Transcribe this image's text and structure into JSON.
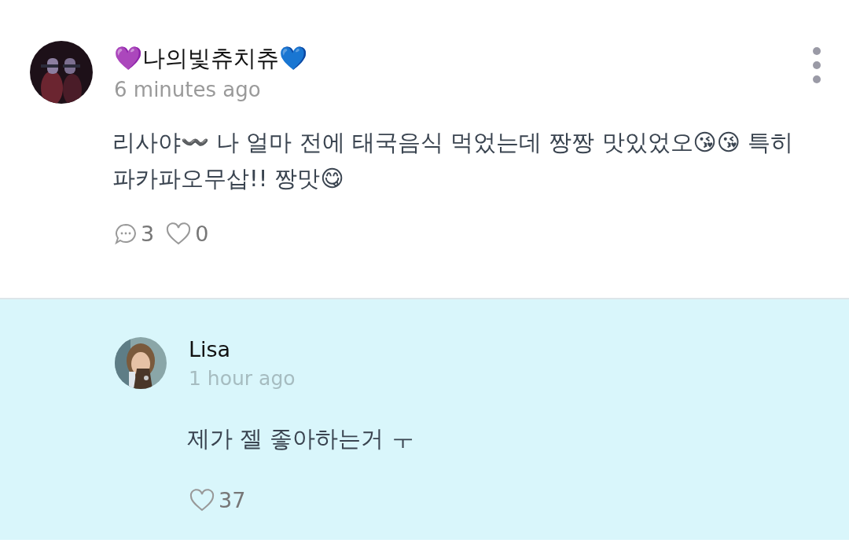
{
  "comment": {
    "author": "💜나의빛츄치츄💙",
    "time": "6 minutes ago",
    "text": "리사야〰️ 나 얼마 전에 태국음식 먹었는데 짱짱 맛있었오😘😘 특히 파카파오무삽!! 짱맛😋",
    "reply_count": "3",
    "likes": "0",
    "highlighted": false
  },
  "reply": {
    "author": "Lisa",
    "time": "1 hour ago",
    "text": "제가 젤 좋아하는거 ㅜ",
    "likes": "37",
    "highlighted": true
  }
}
